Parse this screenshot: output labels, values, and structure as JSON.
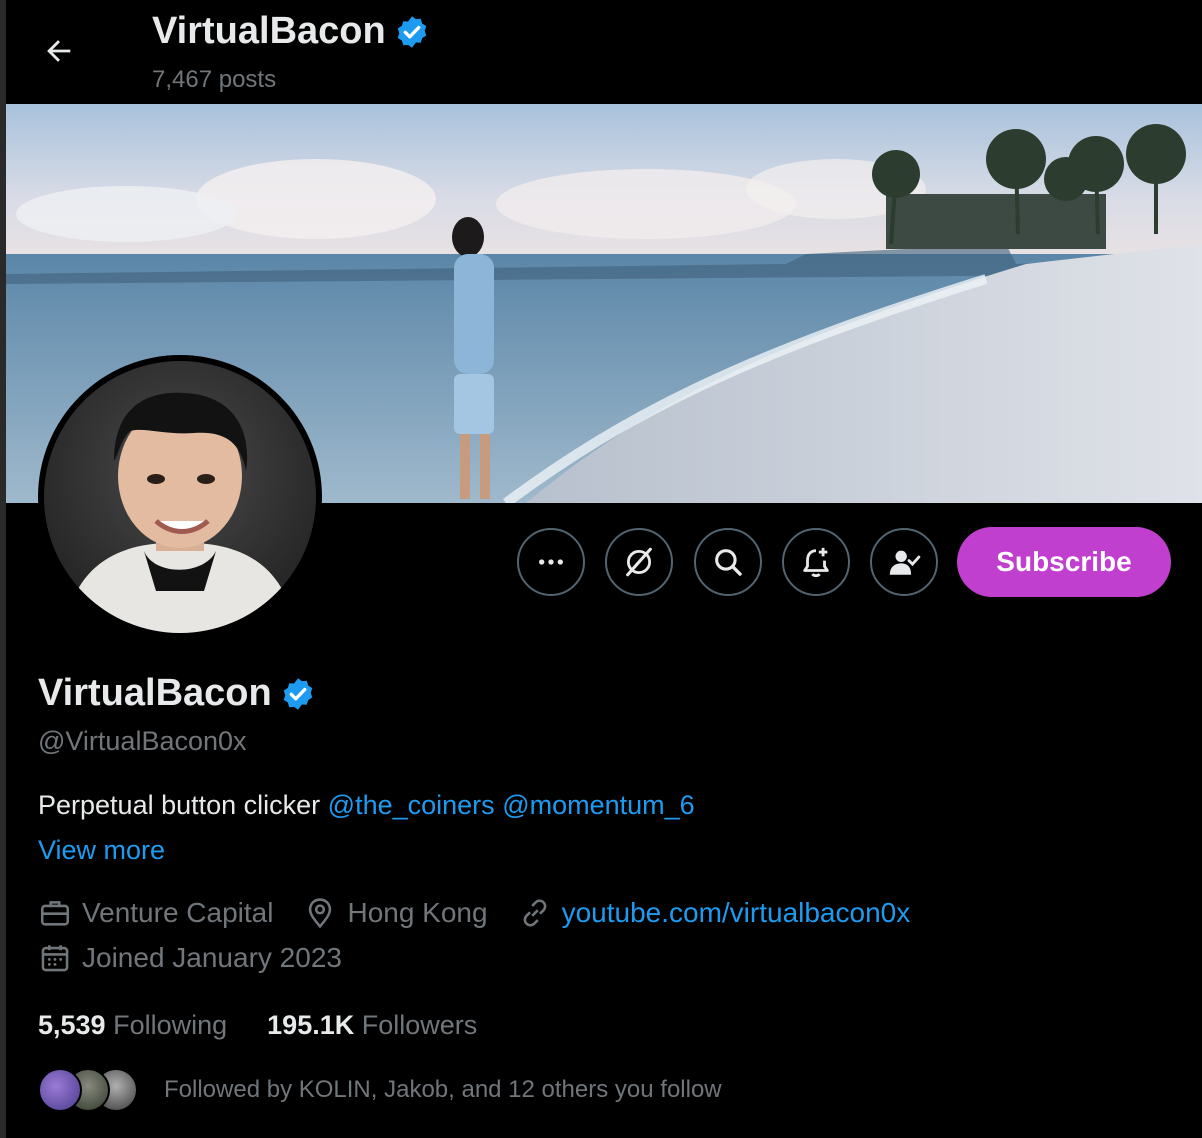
{
  "header": {
    "back_icon": "arrow-left-icon",
    "title": "VirtualBacon",
    "posts": "7,467 posts"
  },
  "profile": {
    "name": "VirtualBacon",
    "handle": "@VirtualBacon0x",
    "verified_icon": "verified-badge-icon",
    "bio_text": "Perpetual button clicker",
    "bio_mentions": [
      "@the_coiners",
      "@momentum_6"
    ],
    "view_more": "View more",
    "category": "Venture Capital",
    "location": "Hong Kong",
    "website": "youtube.com/virtualbacon0x",
    "joined": "Joined January 2023"
  },
  "actions": {
    "more_icon": "more-icon",
    "grok_icon": "grok-icon",
    "search_icon": "search-icon",
    "notify_icon": "bell-plus-icon",
    "following_icon": "person-check-icon",
    "subscribe_label": "Subscribe"
  },
  "stats": {
    "following_count": "5,539",
    "following_label": "Following",
    "followers_count": "195.1K",
    "followers_label": "Followers"
  },
  "followed_by": {
    "text": "Followed by KOLIN, Jakob, and 12 others you follow"
  },
  "colors": {
    "background": "#000000",
    "accent_blue": "#1d9bf0",
    "subscribe_purple": "#c13fce",
    "muted_text": "#71767b",
    "primary_text": "#e7e9ea"
  }
}
